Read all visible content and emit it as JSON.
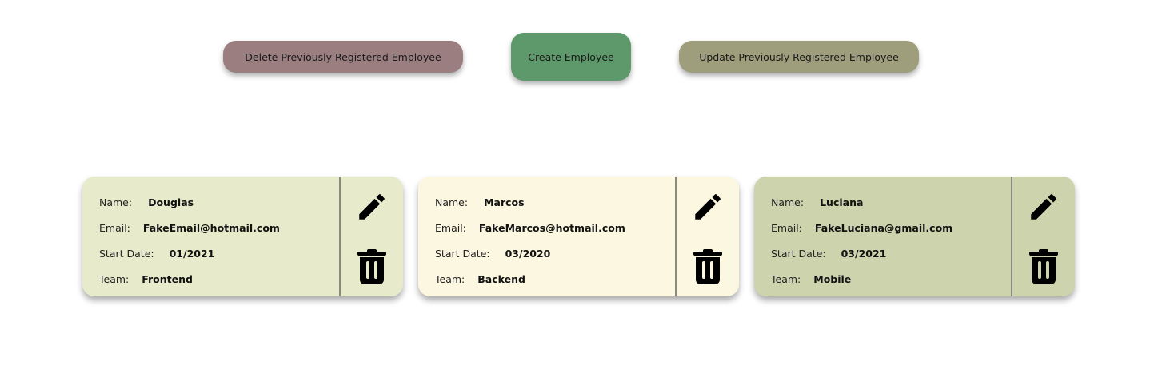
{
  "actions": {
    "delete_label": "Delete Previously Registered Employee",
    "create_label": "Create Employee",
    "update_label": "Update Previously Registered Employee"
  },
  "colors": {
    "delete_button": "#9b7e80",
    "create_button": "#5e996b",
    "update_button": "#9e9d7c",
    "icon": "#000000"
  },
  "field_labels": {
    "name": "Name:",
    "email": "Email:",
    "start_date": "Start Date:",
    "team": "Team:"
  },
  "employees": [
    {
      "name": "Douglas",
      "email": "FakeEmail@hotmail.com",
      "start_date": "01/2021",
      "team": "Frontend",
      "card_color": "#e7ebcb",
      "edit_icon": "pencil-icon",
      "delete_icon": "trash-icon"
    },
    {
      "name": "Marcos",
      "email": "FakeMarcos@hotmail.com",
      "start_date": "03/2020",
      "team": "Backend",
      "card_color": "#fcf7e0",
      "edit_icon": "pencil-icon",
      "delete_icon": "trash-icon"
    },
    {
      "name": "Luciana",
      "email": "FakeLuciana@gmail.com",
      "start_date": "03/2021",
      "team": "Mobile",
      "card_color": "#cdd3ad",
      "edit_icon": "pencil-icon",
      "delete_icon": "trash-icon"
    }
  ]
}
